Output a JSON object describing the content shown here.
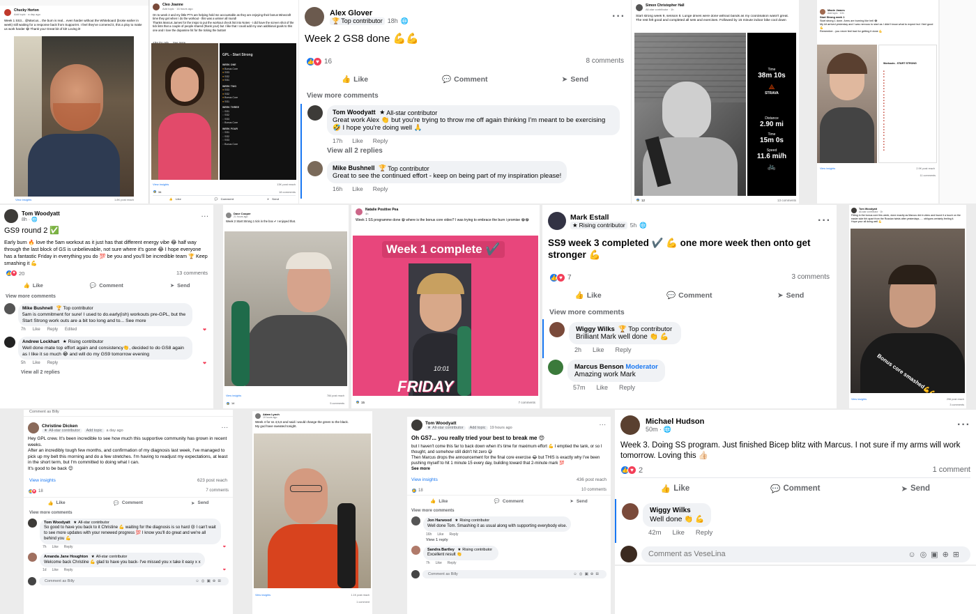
{
  "c1": {
    "name": "Chucky Horton",
    "meta": "Add topic · a day ago",
    "text": "Week 1 SS3... @Marcus... the burn is real... even harder without the Whiteboard (broke earlier in week) still waiting for a response back from SupportAI. I feel they've cornered it, this a ploy to make us work harder 😂 Thank you! Great bit of kit! Loving it!",
    "insights": "View insights",
    "reach": "1.8K post reach"
  },
  "c2": {
    "name": "Cleo Joanne",
    "meta": "Add topic · 16 hours ago",
    "text": "On to week 2 and my little PT's are helping hold me accountable as they are enjoying their bonus Minecraft time they get when I do the workout - this was a winner all round!",
    "text2": "Thanks Marcus James for the inspo to put the workout check list into Notes - I did have the screen shot of the tick lists that a couple of people shared (thank you!) but I like that I could add my own additional goals to this one and I love the dopamine hit for the ticking the button!",
    "text3": "Also it's only ... See more",
    "app_title": "GPL - Start Strong",
    "weeks": [
      "WEEK ONE",
      "WEEK TWO",
      "WEEK THREE",
      "WEEK FOUR"
    ],
    "week_items": [
      [
        "Bonus Core",
        "SS3",
        "SS2",
        "SS1"
      ],
      [
        "SS3",
        "SS2",
        "Bonus Core",
        "SS1"
      ],
      [
        "SS1",
        "SS2",
        "SS3",
        "Bonus Core"
      ],
      [
        "SS1",
        "SS2",
        "SS3",
        "Bonus Core"
      ]
    ],
    "insights": "View insights",
    "reach": "13K post reach",
    "count": "34",
    "comments": "18 comments",
    "like": "Like",
    "comment": "Comment",
    "send": "Send"
  },
  "c3": {
    "name": "Alex Glover",
    "badge": "Top contributor",
    "time": "18h",
    "title": "Week 2 GS8 done 💪💪",
    "count": "16",
    "comments": "8 comments",
    "like": "Like",
    "comment": "Comment",
    "send": "Send",
    "more": "View more comments",
    "cm1": {
      "name": "Tom Woodyatt",
      "badge": "All-star contributor",
      "text": "Great work Alex 👏 but you're trying to throw me off again thinking I'm meant to be exercising 🤣 I hope you're doing well 🙏",
      "time": "17h",
      "like": "Like",
      "reply": "Reply"
    },
    "all_replies": "View all 2 replies",
    "cm2": {
      "name": "Mike Bushnell",
      "badge": "Top contributor",
      "text": "Great to see the continued effort - keep on being part of my inspiration please!",
      "time": "16h",
      "like": "Like",
      "reply": "Reply"
    }
  },
  "c4": {
    "name": "Simon Christopher Hall",
    "meta": "All-star contributor · 1h",
    "text": "Start strong week 9, session 8. Lunge drives were done without bands as my coordination wasn't great. The rest felt good and completed all sets and exercises. Followed by 15 minute indoor bike cool down",
    "time_label": "Time",
    "time_val": "38m 10s",
    "strava": "STRAVA",
    "dist_label": "Distance",
    "dist_val": "2.90 mi",
    "t2_label": "Time",
    "t2_val": "15m 0s",
    "speed_label": "Speed",
    "speed_val": "11.6 mi/h",
    "count": "12",
    "comments": "13 comments"
  },
  "c5": {
    "name": "Maxie James",
    "meta": "Add topic · 10h",
    "text": "Start Strong week 1",
    "text2": "Start strong 1 done. Arms are burning like hell 😂",
    "text3": "My kit arrived yesterday and I was nervous to start as I didn't know what to expect but I feel good 💪",
    "text4": "Remember - you never feel bad for getting it done 💪",
    "app_title": "Workouts - START STRONG",
    "insights": "View insights",
    "reach": "2.9K post reach",
    "comments": "11 comments"
  },
  "c6": {
    "name": "Tom Woodyatt",
    "time": "8h",
    "title": "GS9 round 2 ✅",
    "body": "Early burn 🔥 love the 5am workout as it just has that different energy vibe 😂 half way through the last block of GS is unbelievable, not sure where it's gone 😂 I hope everyone has a fantastic Friday in everything you do 💯 be you and you'll be incredible team 🏆 Keep smashing it 💪",
    "count": "20",
    "comments": "13 comments",
    "like": "Like",
    "comment": "Comment",
    "send": "Send",
    "more": "View more comments",
    "cm1": {
      "name": "Mike Bushnell",
      "badge": "Top contributor",
      "text": "5am is commitment for sure! I used to do.early(ish) workouts pre-GPL, but the Start Strong work outs are a bit too long and to... See more",
      "time": "7h",
      "like": "Like",
      "reply": "Reply",
      "edited": "Edited"
    },
    "cm2": {
      "name": "Andrew Lockhart",
      "badge": "Rising contributor",
      "text": "Well done mate top effort again and consistency👏, decided to do GS8 again as I like it so much 😂 and will do my GS9 tomorrow evening",
      "time": "5h",
      "like": "Like",
      "reply": "Reply"
    },
    "all_replies": "View all 2 replies",
    "bottom": "Comment as Billy"
  },
  "c7": {
    "name": "Dave Cooper",
    "meta": "21 hours ago",
    "text": "Week 2 Start Strong 1 tick in the box ✔ I enjoyed that.",
    "insights": "View insights",
    "reach": "784 post reach",
    "count": "14",
    "comments": "5 comments"
  },
  "c8": {
    "name": "Natalie Positive Pea",
    "meta": "4h",
    "text": "Week 1 SS programme done 😀 where is the bonus core video? I was trying to embrace the burn i promise 😂😂",
    "banner": "Week 1 complete ✔️",
    "clock": "10:01",
    "fri": "FRIDAY",
    "count": "15",
    "comments": "7 comments"
  },
  "c9": {
    "name": "Mark Estall",
    "badge": "Rising contributor",
    "time": "5h",
    "title": "SS9 week 3 completed ✔️ 💪 one more week then onto get stronger 💪",
    "count": "7",
    "comments": "3 comments",
    "like": "Like",
    "comment": "Comment",
    "send": "Send",
    "more": "View more comments",
    "cm1": {
      "name": "Wiggy Wilks",
      "badge": "Top contributor",
      "text": "Brilliant Mark well done 👏 💪",
      "time": "2h",
      "like": "Like",
      "reply": "Reply"
    },
    "cm2": {
      "name": "Marcus Benson",
      "badge": "Moderator",
      "text": "Amazing work Mark",
      "time": "57m",
      "like": "Like",
      "reply": "Reply"
    }
  },
  "c10": {
    "name": "Tom Woodyatt",
    "meta": "All-star contributor · 1h",
    "text": "Fitting in the bonus core this week, done exactly as Marcus did in video and found it a touch on the easier side tbh apart from the Russian twists after yesterdays...... obliques certainly feeling it.",
    "text2": "Hope your all doing well 💪",
    "overlay": "Bonus core smashed💪💪",
    "insights": "View insights",
    "reach": "296 post reach",
    "comments": "3 comments"
  },
  "c11": {
    "top": "Comment as Billy",
    "name": "Christine Dicken",
    "badge": "All-star contributor",
    "topic": "Add topic",
    "meta": "a day ago",
    "body": "Hey GPL crew. It's been incredible to see how much this supportive community has grown in recent weeks.",
    "body2": "After an incredibly tough few months, and confirmation of my diagnosis last week, I've managed to pick up my belt this morning and do a few stretches. I'm having to readjust my expectations, at least in the short term, but I'm committed to doing what I can.",
    "body3": "It's good to be back 😊",
    "insights": "View insights",
    "reach": "623 post reach",
    "count": "18",
    "comments": "7 comments",
    "like": "Like",
    "comment": "Comment",
    "send": "Send",
    "more": "View more comments",
    "cm1": {
      "name": "Tom Woodyatt",
      "badge": "All-star contributor",
      "text": "So good to have you back to it Christine 💪 waiting for the diagnosis is so hard 😢 I can't wait to see more updates with your renewed progress 💯 I know you'll do great and we're all behind you 💪",
      "time": "7h",
      "like": "Like",
      "reply": "Reply"
    },
    "cm2": {
      "name": "Amanda Jane Houghton",
      "badge": "All-star contributor",
      "text": "Welcome back Christine 💪 glad to have you back- I've missed you x take it easy x x",
      "time": "1d",
      "like": "Like",
      "reply": "Reply"
    },
    "bottom": "Comment as Billy"
  },
  "c12": {
    "name": "Adam Lynch",
    "meta": "19 hours ago",
    "text": "Week 4 for ss 4,5,6 and said i would change the green to the black.",
    "text2": "My god have sweated tonight.",
    "insights": "View insights",
    "reach": "1.1K post reach",
    "comments": "1 comment"
  },
  "c13": {
    "name": "Tom Woodyatt",
    "badge": "All-star contributor",
    "topic": "Add topic",
    "meta": "19 hours ago",
    "title": "Oh GS7... you really tried your best to break me 😍",
    "body": "but I haven't come this far to back down when it's time for maximum effort 💪 I emptied the tank, or so I thought, and somehow still didn't hit zero 😅",
    "body2": "Then Marcus drops the announcement for the final core exercise 😂 but THIS is exactly why I've been pushing myself to hit 1 minute 15 every day, building toward that 2-minute mark 💯",
    "see_more": "See more",
    "insights": "View insights",
    "reach": "436 post reach",
    "count": "18",
    "comments": "10 comments",
    "like": "Like",
    "comment": "Comment",
    "send": "Send",
    "more": "View more comments",
    "cm1": {
      "name": "Jon Harwood",
      "badge": "Rising contributor",
      "text": "Well done Tom. Smashing it as usual along with supporting everybody else.",
      "time": "16h",
      "like": "Like",
      "reply": "Reply"
    },
    "reply_link": "View 1 reply",
    "cm2": {
      "name": "Sandra Bartley",
      "badge": "Rising contributor",
      "text": "Excellent result 👏",
      "time": "7h",
      "like": "Like",
      "reply": "Reply"
    },
    "bottom": "Comment as Billy"
  },
  "c14": {
    "name": "Michael Hudson",
    "time": "50m",
    "text": "Week 3. Doing SS program. Just finished Bicep blitz with Marcus. I not sure if my arms will work tomorrow. Loving this 👍🏻",
    "count": "2",
    "comments": "1 comment",
    "like": "Like",
    "comment": "Comment",
    "send": "Send",
    "cm1": {
      "name": "Wiggy Wilks",
      "text": "Well done 👏 💪",
      "time": "42m",
      "like": "Like",
      "reply": "Reply"
    },
    "input_placeholder": "Comment as VeseLina"
  },
  "colors": {
    "fb_blue": "#1877f2",
    "love": "#f33e58",
    "strava": "#fc4c02",
    "banner_pink": "#e8467c"
  }
}
